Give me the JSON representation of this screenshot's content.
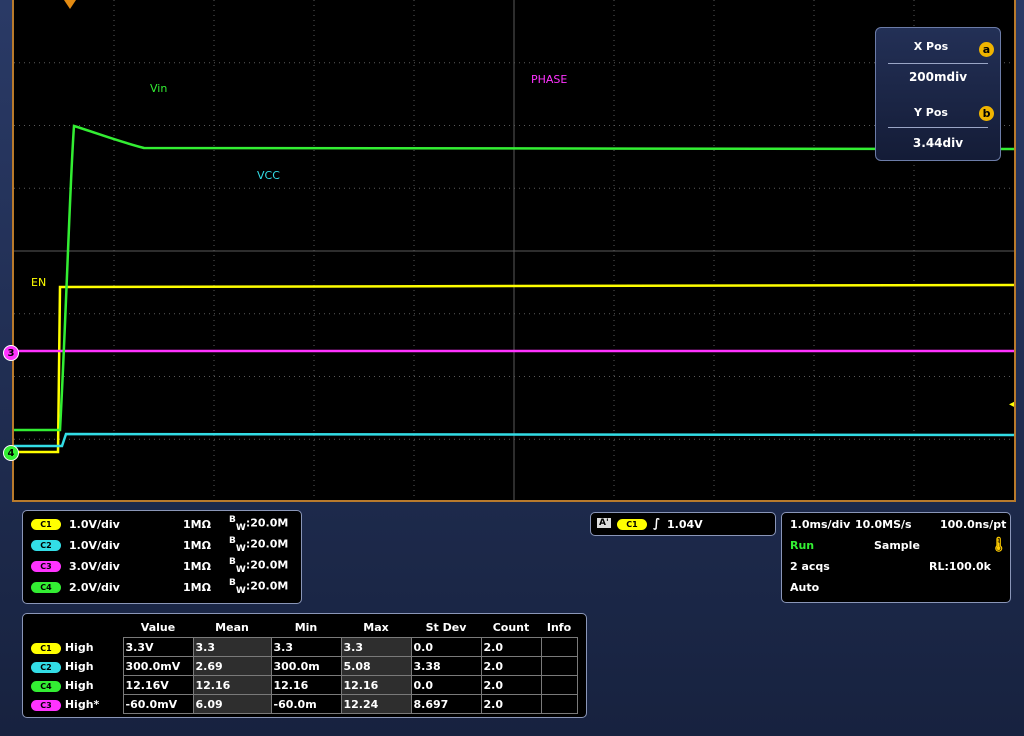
{
  "waveform_labels": {
    "vin": "Vin",
    "vcc": "VCC",
    "en": "EN",
    "phase": "PHASE"
  },
  "markers": {
    "c3": "3",
    "c4": "4"
  },
  "colors": {
    "ch1": "#ffff00",
    "ch2": "#33dde6",
    "ch3": "#ff33ff",
    "ch4": "#33ee33",
    "frame": "#b87a2c"
  },
  "position_panel": {
    "x_label": "X Pos",
    "x_value": "200mdiv",
    "x_knob": "a",
    "y_label": "Y Pos",
    "y_value": "3.44div",
    "y_knob": "b"
  },
  "channels": [
    {
      "badge": "C1",
      "vdiv": "1.0V/div",
      "imp": "1MΩ",
      "bw_sup": "B",
      "bw_sub": "W",
      "bw_val": ":20.0M"
    },
    {
      "badge": "C2",
      "vdiv": "1.0V/div",
      "imp": "1MΩ",
      "bw_sup": "B",
      "bw_sub": "W",
      "bw_val": ":20.0M"
    },
    {
      "badge": "C3",
      "vdiv": "3.0V/div",
      "imp": "1MΩ",
      "bw_sup": "B",
      "bw_sub": "W",
      "bw_val": ":20.0M"
    },
    {
      "badge": "C4",
      "vdiv": "2.0V/div",
      "imp": "1MΩ",
      "bw_sup": "B",
      "bw_sub": "W",
      "bw_val": ":20.0M"
    }
  ],
  "trigger": {
    "mode": "A'",
    "source": "C1",
    "slope": "∫",
    "level": "1.04V"
  },
  "acquisition": {
    "timebase": "1.0ms/div",
    "sample_rate": "10.0MS/s",
    "resolution": "100.0ns/pt",
    "state": "Run",
    "mode": "Sample",
    "acqs": "2 acqs",
    "record_length": "RL:100.0k",
    "trigger_mode": "Auto"
  },
  "measurements": {
    "headers": [
      "Value",
      "Mean",
      "Min",
      "Max",
      "St Dev",
      "Count",
      "Info"
    ],
    "rows": [
      {
        "badge": "C1",
        "type": "High",
        "value": "3.3V",
        "mean": "3.3",
        "min": "3.3",
        "max": "3.3",
        "stdev": "0.0",
        "count": "2.0",
        "info": ""
      },
      {
        "badge": "C2",
        "type": "High",
        "value": "300.0mV",
        "mean": "2.69",
        "min": "300.0m",
        "max": "5.08",
        "stdev": "3.38",
        "count": "2.0",
        "info": ""
      },
      {
        "badge": "C4",
        "type": "High",
        "value": "12.16V",
        "mean": "12.16",
        "min": "12.16",
        "max": "12.16",
        "stdev": "0.0",
        "count": "2.0",
        "info": ""
      },
      {
        "badge": "C3",
        "type": "High*",
        "value": "-60.0mV",
        "mean": "6.09",
        "min": "-60.0m",
        "max": "12.24",
        "stdev": "8.697",
        "count": "2.0",
        "info": ""
      }
    ]
  }
}
